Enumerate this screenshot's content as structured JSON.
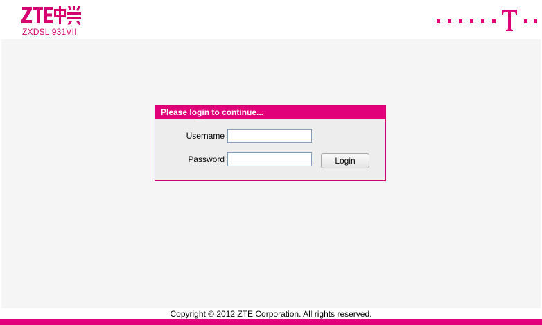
{
  "header": {
    "brand_logo": "ZTE中兴",
    "model": "ZXDSL 931VII",
    "operator_logo": "T"
  },
  "login": {
    "title": "Please login to continue...",
    "username_label": "Username",
    "username_value": "",
    "password_label": "Password",
    "password_value": "",
    "login_button": "Login"
  },
  "footer": {
    "copyright": "Copyright © 2012 ZTE Corporation. All rights reserved."
  },
  "colors": {
    "brand_magenta": "#e2007a",
    "content_background": "#f5f5f5",
    "login_panel_background": "#ededed"
  }
}
